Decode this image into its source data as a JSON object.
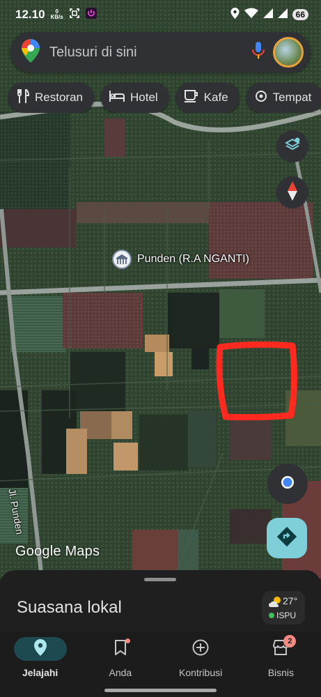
{
  "status_bar": {
    "time": "12.10",
    "net_speed_value": "0",
    "net_speed_unit": "KB/s",
    "battery": "66"
  },
  "search": {
    "placeholder": "Telusuri di sini"
  },
  "chips": [
    {
      "label": "Restoran",
      "icon": "restaurant-icon"
    },
    {
      "label": "Hotel",
      "icon": "hotel-icon"
    },
    {
      "label": "Kafe",
      "icon": "cafe-icon"
    },
    {
      "label": "Tempat",
      "icon": "attraction-icon"
    }
  ],
  "map": {
    "place_label": "Punden (R.A NGANTI)",
    "road_label": "Jl. Punden",
    "watermark": "Google Maps",
    "highlight_color": "#ff2a1f"
  },
  "sheet": {
    "title": "Suasana lokal",
    "weather_temp": "27°",
    "weather_status": "ISPU"
  },
  "nav": {
    "items": [
      {
        "label": "Jelajahi",
        "icon": "explore-pin-icon"
      },
      {
        "label": "Anda",
        "icon": "bookmark-icon"
      },
      {
        "label": "Kontribusi",
        "icon": "add-circle-icon"
      },
      {
        "label": "Bisnis",
        "icon": "store-icon",
        "badge": "2"
      }
    ]
  },
  "colors": {
    "accent": "#7fcfd9",
    "active_nav": "#1d4a50",
    "surface": "#303134"
  }
}
